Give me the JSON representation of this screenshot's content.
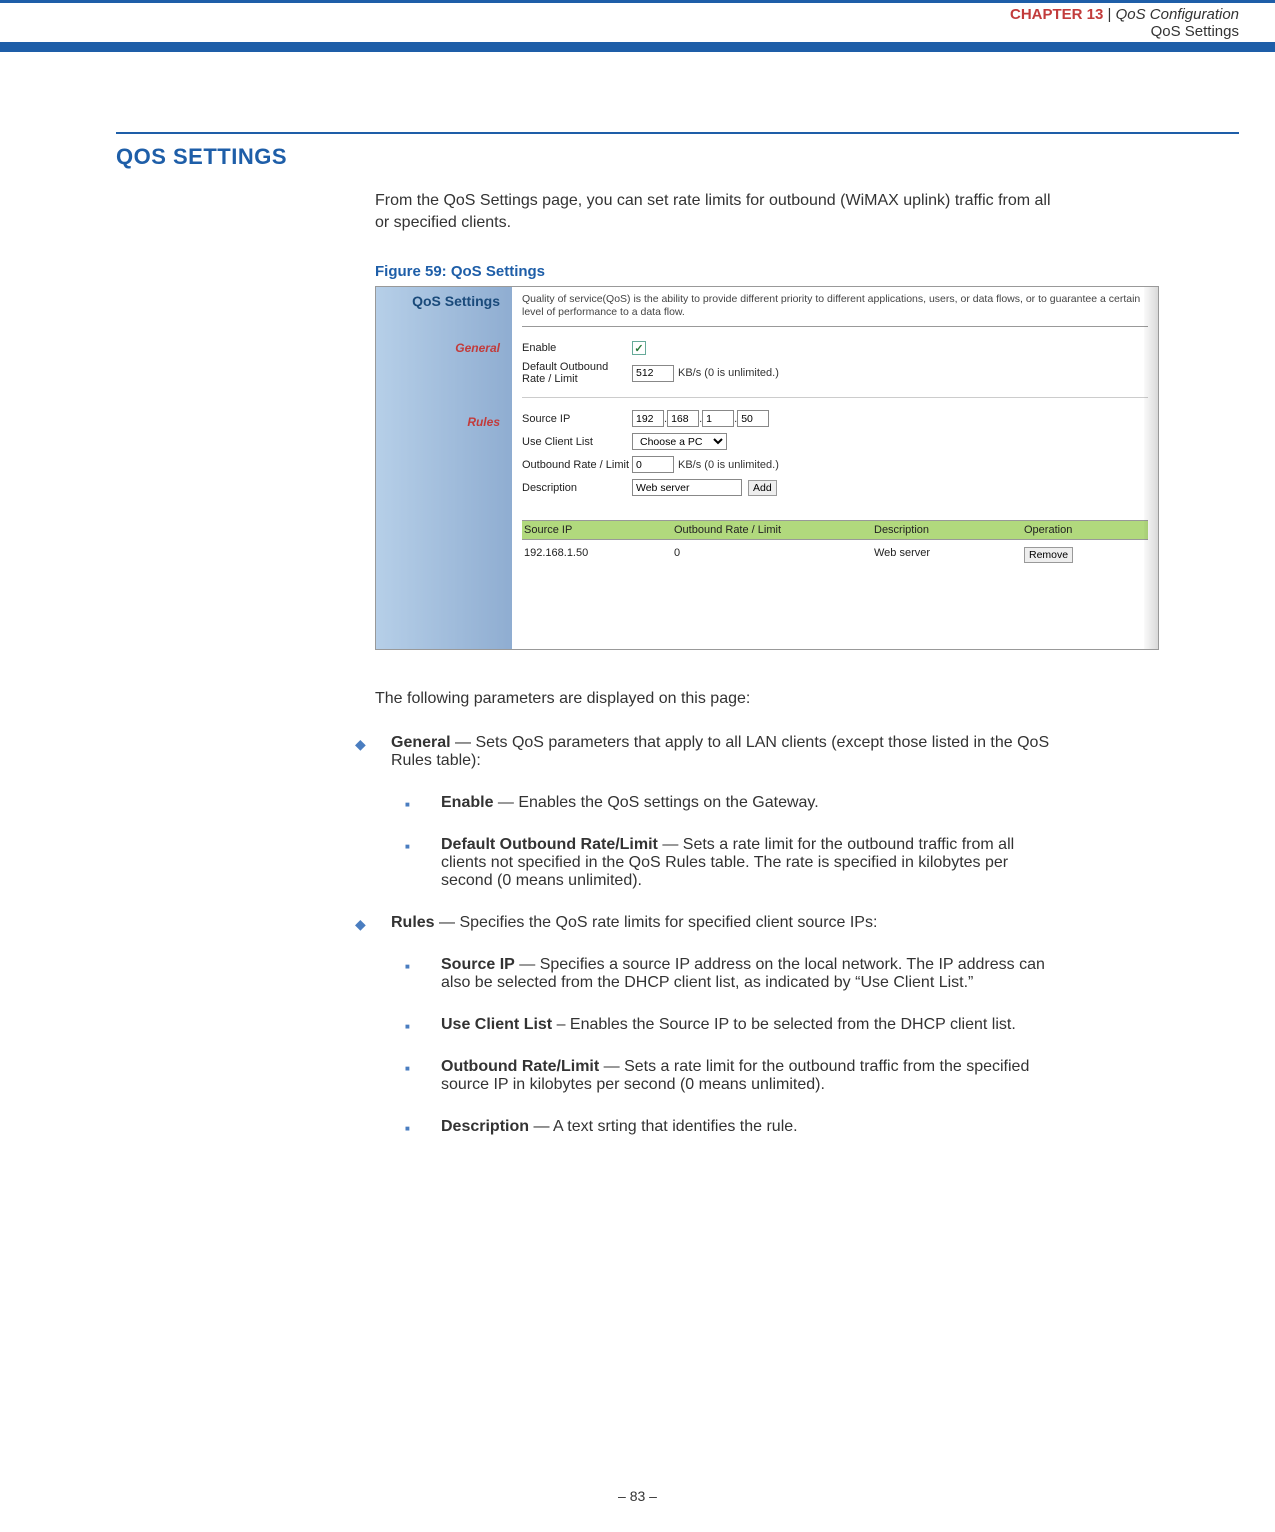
{
  "header": {
    "chapter_label": "CHAPTER 13",
    "separator": "|",
    "chapter_title": "QoS Configuration",
    "subtitle": "QoS Settings"
  },
  "section_title": "QOS SETTINGS",
  "intro": "From the QoS Settings page, you can set rate limits for outbound (WiMAX uplink) traffic from all or specified clients.",
  "figure_caption": "Figure 59:  QoS Settings",
  "screenshot": {
    "sidebar": {
      "title": "QoS Settings",
      "items": [
        "General",
        "Rules"
      ]
    },
    "description": "Quality of service(QoS) is the ability to provide different priority to different applications, users, or data flows, or to guarantee a certain level of performance to a data flow.",
    "general": {
      "enable_label": "Enable",
      "enable_checked": "✓",
      "rate_label": "Default Outbound Rate / Limit",
      "rate_value": "512",
      "rate_unit": "KB/s (0 is unlimited.)"
    },
    "rules_form": {
      "source_ip_label": "Source IP",
      "ip": [
        "192",
        "168",
        "1",
        "50"
      ],
      "client_list_label": "Use Client List",
      "client_list_value": "Choose a PC",
      "rate_label": "Outbound Rate / Limit",
      "rate_value": "0",
      "rate_unit": "KB/s (0 is unlimited.)",
      "desc_label": "Description",
      "desc_value": "Web server",
      "add_btn": "Add"
    },
    "table": {
      "headers": [
        "Source IP",
        "Outbound Rate / Limit",
        "Description",
        "Operation"
      ],
      "row": {
        "source_ip": "192.168.1.50",
        "rate": "0",
        "desc": "Web server",
        "remove_btn": "Remove"
      }
    }
  },
  "params_intro": "The following parameters are displayed on this page:",
  "bullets": {
    "general": {
      "label": "General",
      "text": " — Sets QoS parameters that apply to all LAN clients (except those listed in the QoS Rules table):",
      "sub": {
        "enable": {
          "label": "Enable",
          "text": " — Enables the QoS settings on the Gateway."
        },
        "default_rate": {
          "label": "Default Outbound Rate/Limit",
          "text": " — Sets a rate limit for the outbound traffic from all clients not specified in the QoS Rules table. The rate is specified in kilobytes per second (0 means unlimited)."
        }
      }
    },
    "rules": {
      "label": "Rules",
      "text": " — Specifies the QoS rate limits for specified client source IPs:",
      "sub": {
        "source_ip": {
          "label": "Source IP",
          "text": " — Specifies a source IP address on the local network. The IP address can also be selected from the DHCP client list, as indicated by “Use Client List.”"
        },
        "client_list": {
          "label": "Use Client List",
          "text": " – Enables the Source IP to be selected from the DHCP client list."
        },
        "rate": {
          "label": "Outbound Rate/Limit",
          "text": " — Sets a rate limit for the outbound traffic from the specified source IP in kilobytes per second (0 means unlimited)."
        },
        "desc": {
          "label": "Description",
          "text": " — A text srting that identifies the rule."
        }
      }
    }
  },
  "footer": "–  83  –"
}
